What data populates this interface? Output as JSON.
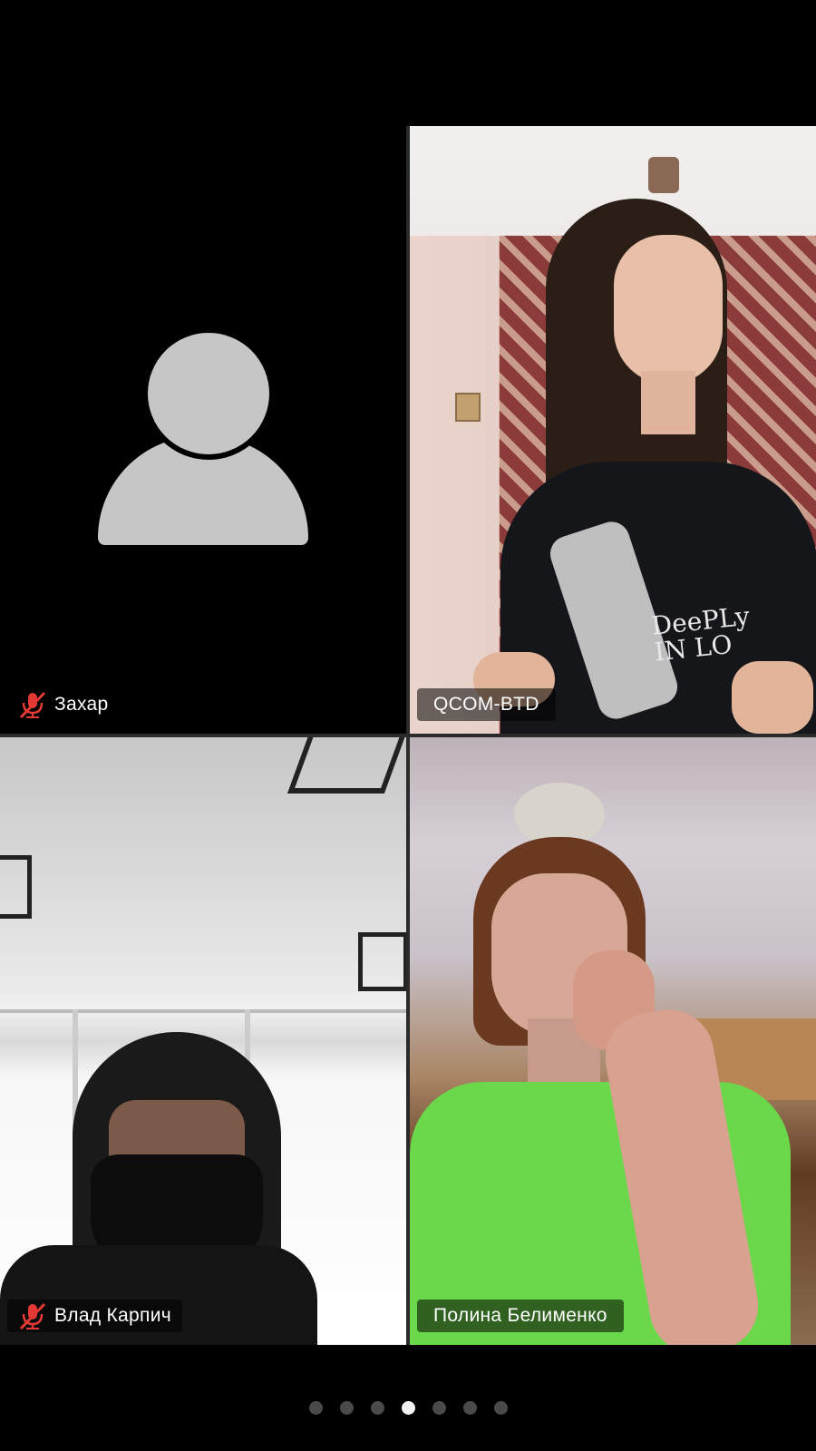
{
  "participants": [
    {
      "name": "Захар",
      "muted": true,
      "video": false
    },
    {
      "name": "QCOM-BTD",
      "muted": false,
      "video": true,
      "shirt_text": "DeePLy IN LO"
    },
    {
      "name": "Влад Карпич",
      "muted": true,
      "video": true
    },
    {
      "name": "Полина Белименко",
      "muted": false,
      "video": true
    }
  ],
  "pagination": {
    "total": 7,
    "current_index": 3
  },
  "colors": {
    "muted_icon": "#e53935",
    "active_dot": "#f2f2f2",
    "inactive_dot": "#4a4a4a"
  }
}
